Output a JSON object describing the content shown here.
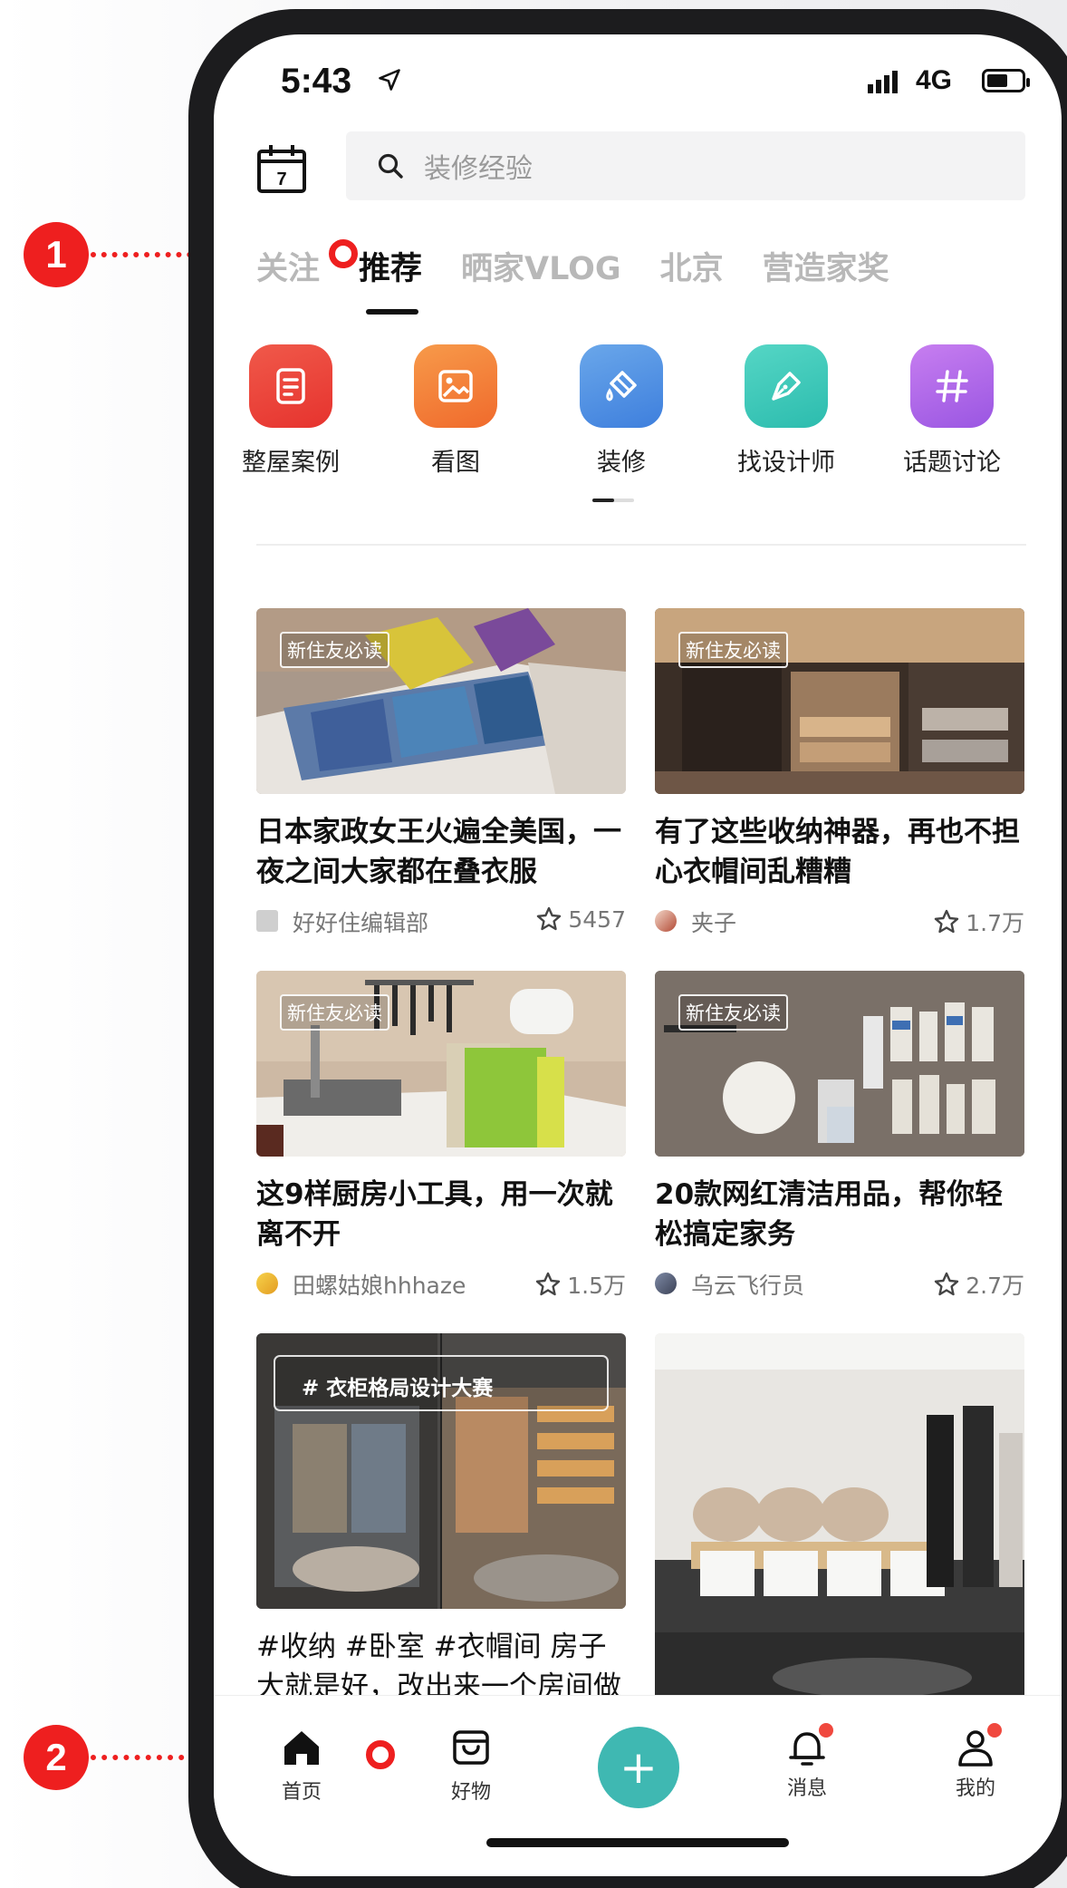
{
  "annotations": [
    "1",
    "2"
  ],
  "status_bar": {
    "time": "5:43",
    "network": "4G"
  },
  "search": {
    "placeholder": "装修经验"
  },
  "calendar": {
    "day": "7"
  },
  "tabs": [
    "关注",
    "推荐",
    "晒家VLOG",
    "北京",
    "营造家奖"
  ],
  "active_tab_index": 1,
  "categories": [
    {
      "label": "整屋案例",
      "icon": "document-icon",
      "color_from": "#f0594a",
      "color_to": "#e6332e"
    },
    {
      "label": "看图",
      "icon": "image-icon",
      "color_from": "#f79a4a",
      "color_to": "#f06a2c"
    },
    {
      "label": "装修",
      "icon": "paint-bucket-icon",
      "color_from": "#6aa7ea",
      "color_to": "#3e7fdd"
    },
    {
      "label": "找设计师",
      "icon": "pen-nib-icon",
      "color_from": "#55d6c5",
      "color_to": "#2cbcae"
    },
    {
      "label": "话题讨论",
      "icon": "hashtag-icon",
      "color_from": "#c77ef0",
      "color_to": "#9a56e2"
    }
  ],
  "feed": [
    {
      "tag": "新住友必读",
      "title": "日本家政女王火遍全美国，一夜之间大家都在叠衣服",
      "author": "好好住编辑部",
      "likes": "5457"
    },
    {
      "tag": "新住友必读",
      "title": "有了这些收纳神器，再也不担心衣帽间乱糟糟",
      "author": "夹子",
      "likes": "1.7万"
    },
    {
      "tag": "新住友必读",
      "title": "这9样厨房小工具，用一次就离不开",
      "author": "田螺姑娘hhhaze",
      "likes": "1.5万"
    },
    {
      "tag": "新住友必读",
      "title": "20款网红清洁用品，帮你轻松搞定家务",
      "author": "乌云飞行员",
      "likes": "2.7万"
    },
    {
      "tag": "# 衣柜格局设计大赛",
      "title": "#收纳 #卧室 #衣帽间 房子大就是好，改出来一个房间做衣"
    },
    {}
  ],
  "tabbar": {
    "home": "首页",
    "goods": "好物",
    "add": "+",
    "messages": "消息",
    "mine": "我的"
  },
  "colors": {
    "accent": "#3fb8b2",
    "annotation": "#ee1f1f",
    "badge": "#f0483e"
  }
}
